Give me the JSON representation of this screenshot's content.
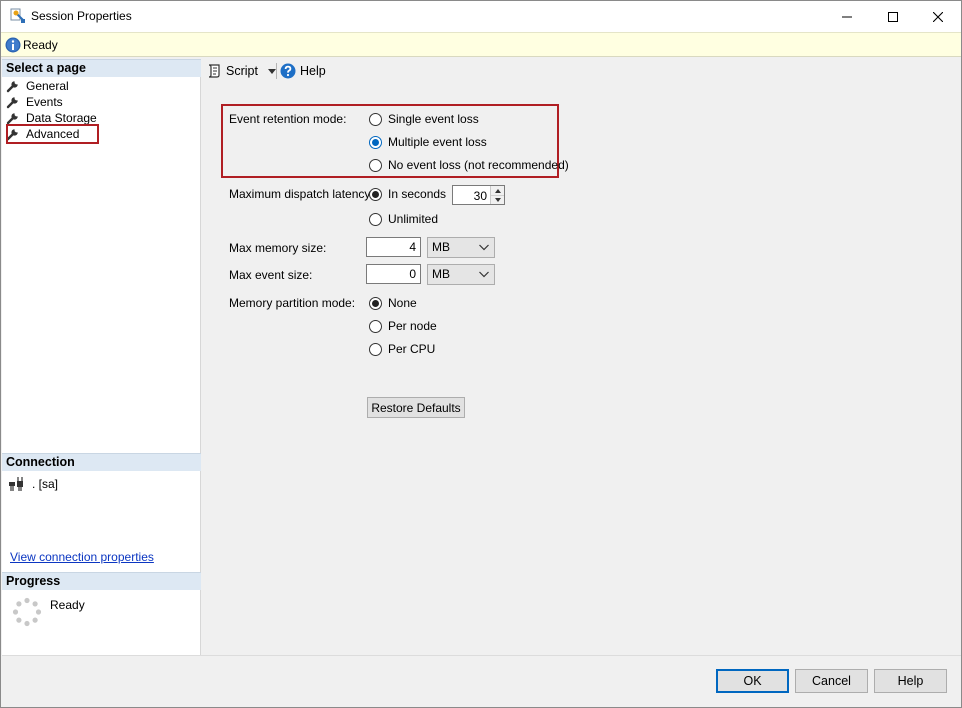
{
  "window": {
    "title": "Session Properties",
    "status": "Ready",
    "caption_buttons": [
      "minimize-icon",
      "maximize-icon",
      "close-icon"
    ]
  },
  "left": {
    "select_page_header": "Select a page",
    "pages": [
      {
        "label": "General",
        "icon": "wrench-icon"
      },
      {
        "label": "Events",
        "icon": "wrench-icon"
      },
      {
        "label": "Data Storage",
        "icon": "wrench-icon"
      },
      {
        "label": "Advanced",
        "icon": "wrench-icon",
        "selected": true
      }
    ],
    "connection_header": "Connection",
    "connection_value": ". [sa]",
    "connection_link": "View connection properties",
    "progress_header": "Progress",
    "progress_status": "Ready"
  },
  "toolbar": {
    "script_label": "Script",
    "help_label": "Help"
  },
  "form": {
    "retention_label": "Event retention mode:",
    "retention_options": [
      "Single event loss",
      "Multiple event loss",
      "No event loss (not recommended)"
    ],
    "retention_selected": "Multiple event loss",
    "dispatch_label": "Maximum dispatch latency:",
    "dispatch_options": [
      "In seconds",
      "Unlimited"
    ],
    "dispatch_selected": "In seconds",
    "dispatch_seconds": "30",
    "memory_label": "Max memory size:",
    "memory_value": "4",
    "memory_unit": "MB",
    "event_size_label": "Max event size:",
    "event_size_value": "0",
    "event_size_unit": "MB",
    "partition_label": "Memory partition mode:",
    "partition_options": [
      "None",
      "Per node",
      "Per CPU"
    ],
    "partition_selected": "None",
    "restore_defaults": "Restore Defaults"
  },
  "footer": {
    "ok": "OK",
    "cancel": "Cancel",
    "help": "Help"
  },
  "colors": {
    "highlight_border": "#b01e23",
    "accent": "#0067c0",
    "status_bg": "#ffffe1",
    "section_header_bg": "#dde8f3",
    "link": "#0b36c2"
  }
}
